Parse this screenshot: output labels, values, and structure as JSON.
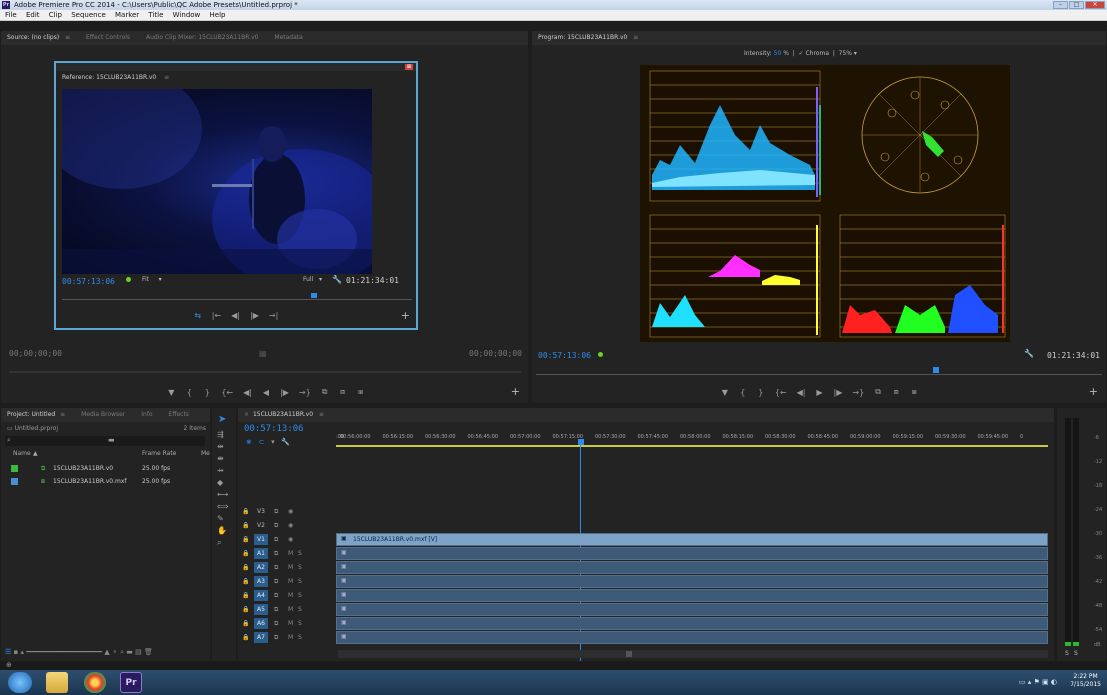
{
  "window": {
    "app_badge": "Pr",
    "title": "Adobe Premiere Pro CC 2014 - C:\\Users\\Public\\QC Adobe Presets\\Untitled.prproj *",
    "minimize": "–",
    "maximize": "□",
    "close": "✕"
  },
  "menu": [
    "File",
    "Edit",
    "Clip",
    "Sequence",
    "Marker",
    "Title",
    "Window",
    "Help"
  ],
  "source_panel": {
    "tabs": [
      "Source: (no clips)",
      "≡",
      "Effect Controls",
      "Audio Clip Mixer: 15CLUB23A11BR.v0",
      "Metadata"
    ],
    "timecode_left": "00;00;00;00",
    "timecode_right": "00;00;00;00",
    "controls": [
      "▼",
      "{",
      "}",
      "{←",
      "◀|",
      "◀",
      "|▶",
      "→}",
      "⧉",
      "⧈",
      "⧆"
    ],
    "add": "+"
  },
  "reference_monitor": {
    "title": "Reference: 15CLUB23A11BR.v0",
    "menu": "≡",
    "close": "⊠",
    "timecode": "00:57:13:06",
    "fit": "Fit",
    "quality": "Full",
    "duration": "01:21:34:01",
    "controls": [
      "⇆",
      "|←",
      "◀|",
      "|▶",
      "→|"
    ],
    "add": "+"
  },
  "program_panel": {
    "tab": "Program: 15CLUB23A11BR.v0",
    "tab_menu": "≡",
    "intensity_label": "Intensity:",
    "intensity_value": "50",
    "intensity_unit": "%",
    "chroma_label": "✓ Chroma",
    "zoom": "75%",
    "timecode": "00:57:13:06",
    "duration": "01:21:34:01",
    "controls": [
      "▼",
      "{",
      "}",
      "{←",
      "◀|",
      "▶",
      "|▶",
      "→}",
      "⧉",
      "⧈",
      "⧆"
    ],
    "add": "+"
  },
  "project_panel": {
    "tabs": [
      "Project: Untitled",
      "≡",
      "Media Browser",
      "Info",
      "Effects"
    ],
    "file": "Untitled.prproj",
    "item_count": "2 Items",
    "columns": [
      "Name",
      "Frame Rate",
      "Me"
    ],
    "rows": [
      {
        "name": "15CLUB23A11BR.v0",
        "rate": "25.00 fps",
        "color": "#3cb83c"
      },
      {
        "name": "15CLUB23A11BR.v0.mxf",
        "rate": "25.00 fps",
        "color": "#4a8fd6"
      }
    ]
  },
  "timeline": {
    "tab": "15CLUB23A11BR.v0",
    "tab_close": "×",
    "tab_menu": "≡",
    "timecode": "00:57:13:06",
    "ruler": [
      ":00",
      "00:56:00:00",
      "00:56:15:00",
      "00:56:30:00",
      "00:56:45:00",
      "00:57:00:00",
      "00:57:15:00",
      "00:57:30:00",
      "00:57:45:00",
      "00:58:00:00",
      "00:58:15:00",
      "00:58:30:00",
      "00:58:45:00",
      "00:59:00:00",
      "00:59:15:00",
      "00:59:30:00",
      "00:59:45:00",
      "0"
    ],
    "tracks": [
      {
        "label": "V3",
        "type": "video",
        "selected": false,
        "clip": ""
      },
      {
        "label": "V2",
        "type": "video",
        "selected": false,
        "clip": ""
      },
      {
        "label": "V1",
        "type": "video",
        "selected": true,
        "clip": "15CLUB23A11BR.v0.mxf [V]"
      },
      {
        "label": "A1",
        "type": "audio",
        "selected": true,
        "clip": ""
      },
      {
        "label": "A2",
        "type": "audio",
        "selected": true,
        "clip": ""
      },
      {
        "label": "A3",
        "type": "audio",
        "selected": true,
        "clip": ""
      },
      {
        "label": "A4",
        "type": "audio",
        "selected": true,
        "clip": ""
      },
      {
        "label": "A5",
        "type": "audio",
        "selected": true,
        "clip": ""
      },
      {
        "label": "A6",
        "type": "audio",
        "selected": true,
        "clip": ""
      },
      {
        "label": "A7",
        "type": "audio",
        "selected": true,
        "clip": ""
      }
    ]
  },
  "audio_meter": {
    "scale": [
      "-6",
      "-12",
      "-18",
      "-24",
      "-30",
      "-36",
      "-42",
      "-48",
      "-54",
      "dB"
    ],
    "solo_left": "S",
    "solo_right": "S"
  },
  "taskbar": {
    "clock_time": "2:22 PM",
    "clock_date": "7/15/2015"
  }
}
